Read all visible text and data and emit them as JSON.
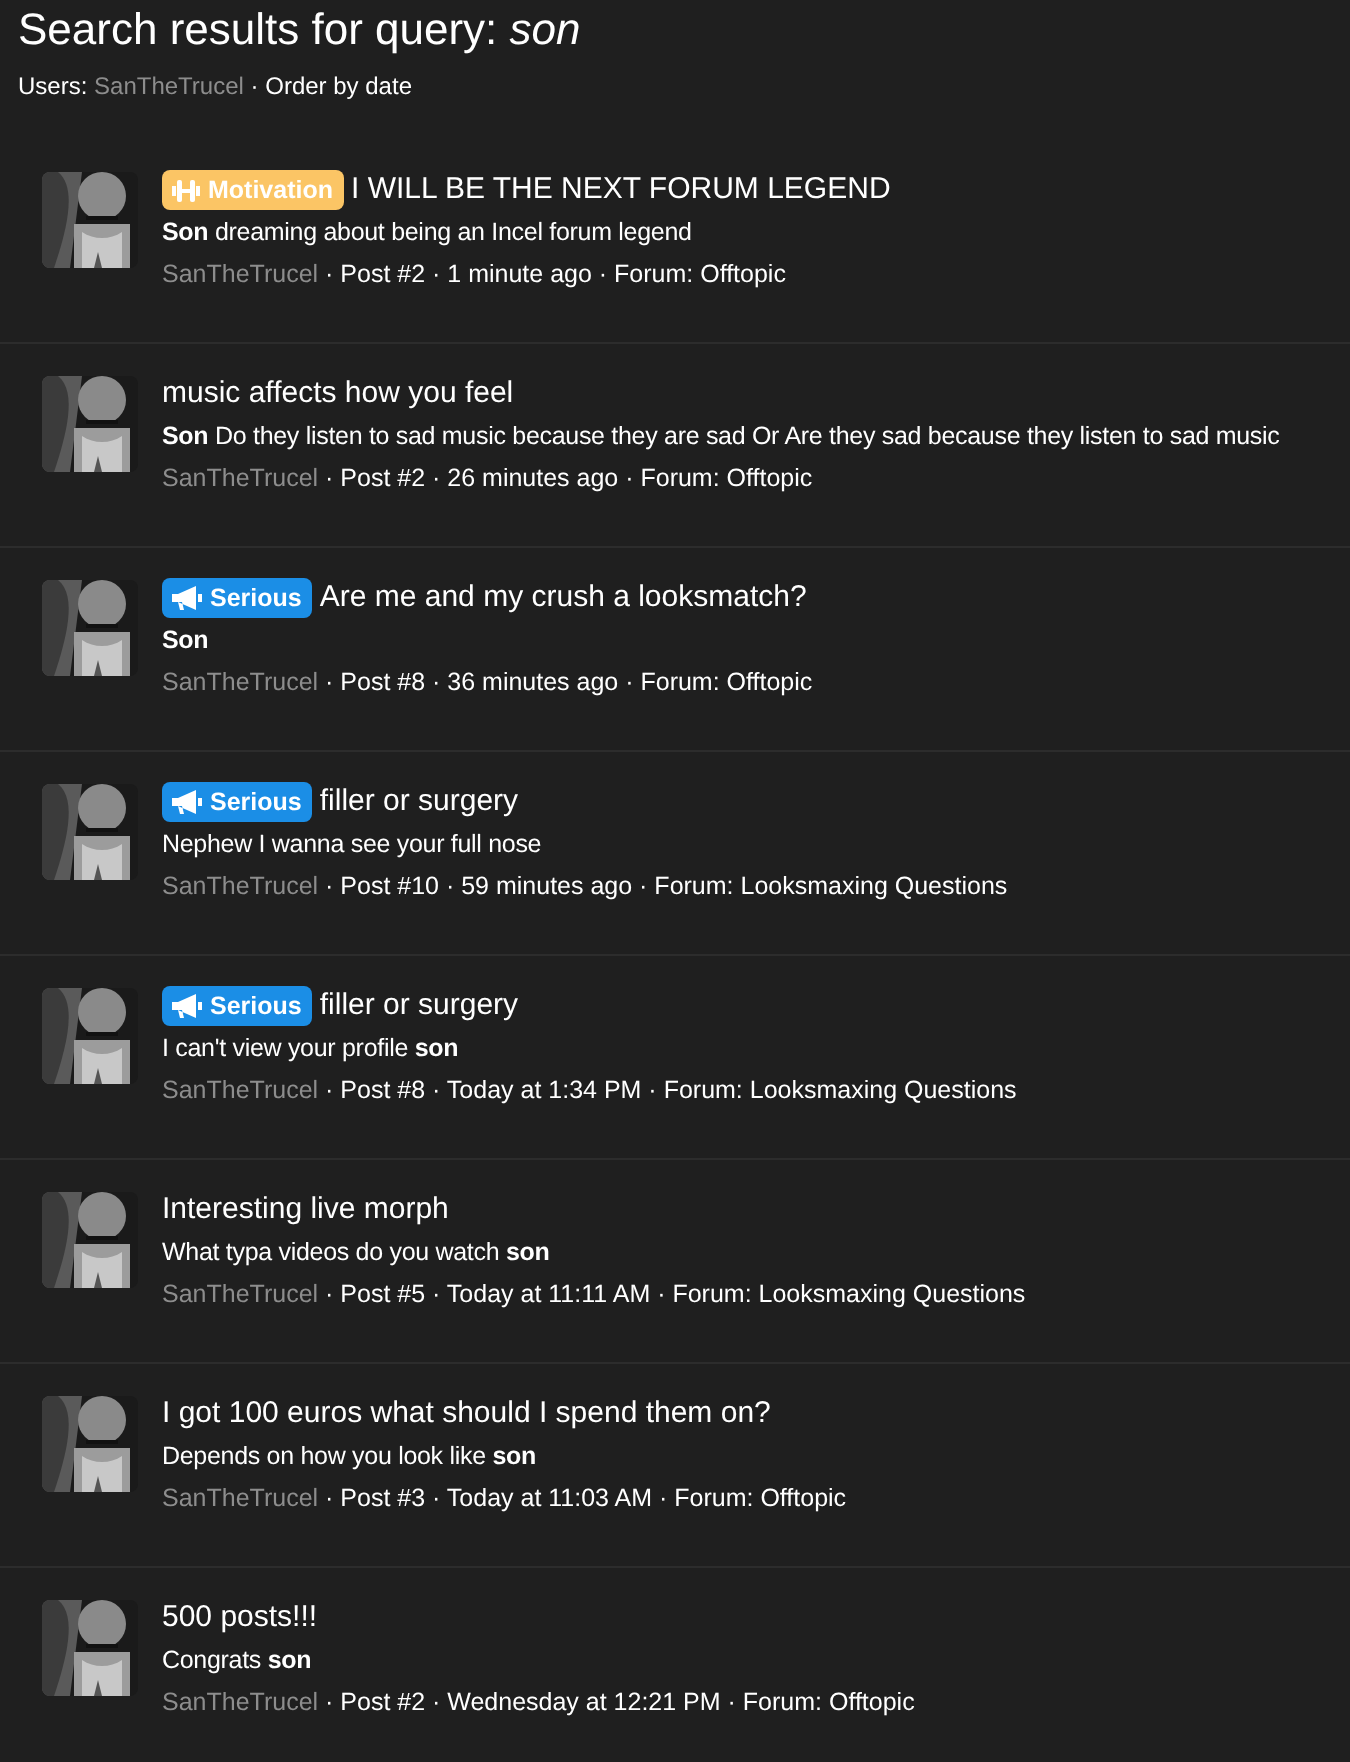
{
  "heading": "Search results for query: *son*",
  "filters": {
    "label": "Users:",
    "user": "SanTheTrucel",
    "order": "· Order by date"
  },
  "results": [
    {
      "prefix": {
        "kind": "motivation",
        "label": "Motivation"
      },
      "title": "I WILL BE THE NEXT FORUM LEGEND",
      "snippet": "**Son** dreaming about being an Incel forum legend",
      "author": "SanTheTrucel",
      "meta": "· Post #2 · 1 minute ago · Forum: Offtopic"
    },
    {
      "title": "music affects how you feel",
      "snippet": "**Son** Do they listen to sad music because they are sad Or Are they sad because they listen to sad music",
      "author": "SanTheTrucel",
      "meta": "· Post #2 · 26 minutes ago · Forum: Offtopic"
    },
    {
      "prefix": {
        "kind": "serious",
        "label": "Serious"
      },
      "title": "Are me and my crush a looksmatch?",
      "snippet": "**Son**",
      "author": "SanTheTrucel",
      "meta": "· Post #8 · 36 minutes ago · Forum: Offtopic"
    },
    {
      "prefix": {
        "kind": "serious",
        "label": "Serious"
      },
      "title": "filler or surgery",
      "snippet": "Nephew I wanna see your full nose",
      "author": "SanTheTrucel",
      "meta": "· Post #10 · 59 minutes ago · Forum: Looksmaxing Questions"
    },
    {
      "prefix": {
        "kind": "serious",
        "label": "Serious"
      },
      "title": "filler or surgery",
      "snippet": "I can't view your profile **son**",
      "author": "SanTheTrucel",
      "meta": "· Post #8 · Today at 1:34 PM · Forum: Looksmaxing Questions"
    },
    {
      "title": "Interesting live morph",
      "snippet": "What typa videos do you watch **son**",
      "author": "SanTheTrucel",
      "meta": "· Post #5 · Today at 11:11 AM · Forum: Looksmaxing Questions"
    },
    {
      "title": "I got 100 euros what should I spend them on?",
      "snippet": "Depends on how you look like **son**",
      "author": "SanTheTrucel",
      "meta": "· Post #3 · Today at 11:03 AM · Forum: Offtopic"
    },
    {
      "title": "500 posts!!!",
      "snippet": "Congrats **son**",
      "author": "SanTheTrucel",
      "meta": "· Post #2 · Wednesday at 12:21 PM · Forum: Offtopic"
    }
  ]
}
